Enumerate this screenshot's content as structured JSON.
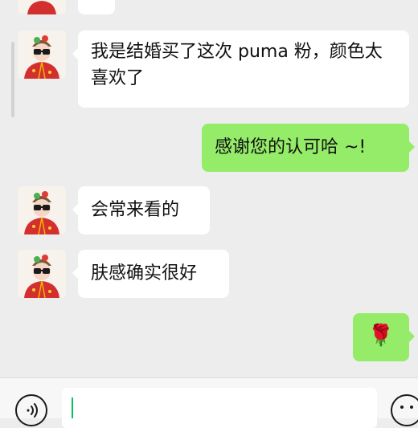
{
  "messages": [
    {
      "side": "left",
      "text": ""
    },
    {
      "side": "left",
      "text": "我是结婚买了这次 puma 粉，颜色太喜欢了"
    },
    {
      "side": "right",
      "text": "感谢您的认可哈 ~!"
    },
    {
      "side": "left",
      "text": "会常来看的"
    },
    {
      "side": "left",
      "text": "肤感确实很好"
    },
    {
      "side": "right",
      "text": "🌹"
    }
  ],
  "icons": {
    "voice": "voice-icon",
    "emoji": "emoji-icon",
    "rose": "rose-emoji"
  },
  "colors": {
    "background": "#ededed",
    "incoming_bubble": "#ffffff",
    "outgoing_bubble": "#95ec69",
    "cursor": "#07c160"
  }
}
